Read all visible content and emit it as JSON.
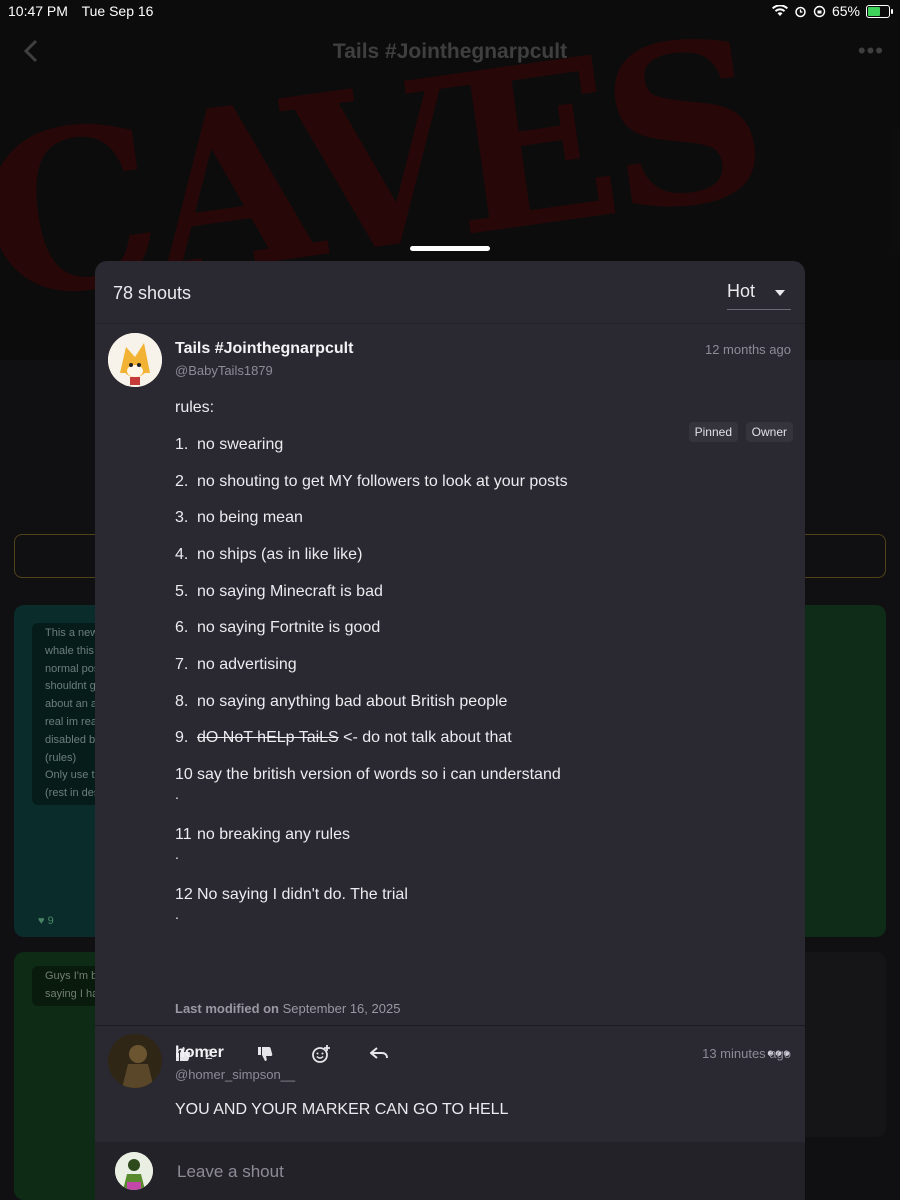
{
  "status_bar": {
    "time": "10:47 PM",
    "date": "Tue Sep 16",
    "battery": "65%",
    "battery_level": 0.65
  },
  "background": {
    "graffiti_text": "CAVES",
    "title": "Tails #Jointhegnarpcult",
    "back_icon": "chevron-left-icon",
    "more_icon": "more-horizontal-icon",
    "card1_lines": [
      "This a new",
      "whale this",
      "normal pos",
      "shouldnt g",
      "about an a",
      "real im rea",
      "disabled by",
      "(rules)",
      "Only use th",
      "(rest in des"
    ],
    "card1_likes": "9",
    "card2_lines": [
      "Guys I'm b",
      "saying I ha"
    ]
  },
  "sheet": {
    "shout_count": "78 shouts",
    "sort": {
      "selected": "Hot",
      "options": [
        "Hot"
      ]
    }
  },
  "pinned_post": {
    "author": "Tails #Jointhegnarpcult",
    "handle": "@BabyTails1879",
    "time": "12 months ago",
    "tags": [
      "Pinned",
      "Owner"
    ],
    "intro": "rules:",
    "rules": [
      {
        "num": "1.",
        "text": "no swearing"
      },
      {
        "num": "2.",
        "text": "no shouting to get MY followers to look at your posts"
      },
      {
        "num": "3.",
        "text": "no being mean"
      },
      {
        "num": "4.",
        "text": "no ships (as in like like)"
      },
      {
        "num": "5.",
        "text": "no saying Minecraft is bad"
      },
      {
        "num": "6.",
        "text": "no saying Fortnite is good"
      },
      {
        "num": "7.",
        "text": "no advertising"
      },
      {
        "num": "8.",
        "text": "no saying anything bad about British people"
      },
      {
        "num": "9.",
        "struck": "dO NoT hELp TaiLS",
        "text": " <- do not talk about that"
      },
      {
        "num": "10",
        "text": "say the british version of words so i can understand",
        "dot": "."
      },
      {
        "num": "11",
        "text": "no breaking any rules",
        "dot": "."
      },
      {
        "num": "12",
        "text": "No saying I didn't do. The trial",
        "dot": "."
      }
    ],
    "last_modified_label": "Last modified on",
    "last_modified_date": "September 16, 2025",
    "like_count": "2",
    "icons": [
      "thumbs-up-icon",
      "thumbs-down-icon",
      "add-reaction-icon",
      "reply-icon",
      "more-horizontal-icon"
    ]
  },
  "reply_post": {
    "author": "homer",
    "handle": "@homer_simpson__",
    "time": "13 minutes ago",
    "text": "YOU AND YOUR MARKER CAN GO TO HELL"
  },
  "composer": {
    "placeholder": "Leave a shout"
  },
  "colors": {
    "sheet_bg": "#2a2830",
    "accent_border": "#6b5a22",
    "battery": "#3ed35a"
  }
}
